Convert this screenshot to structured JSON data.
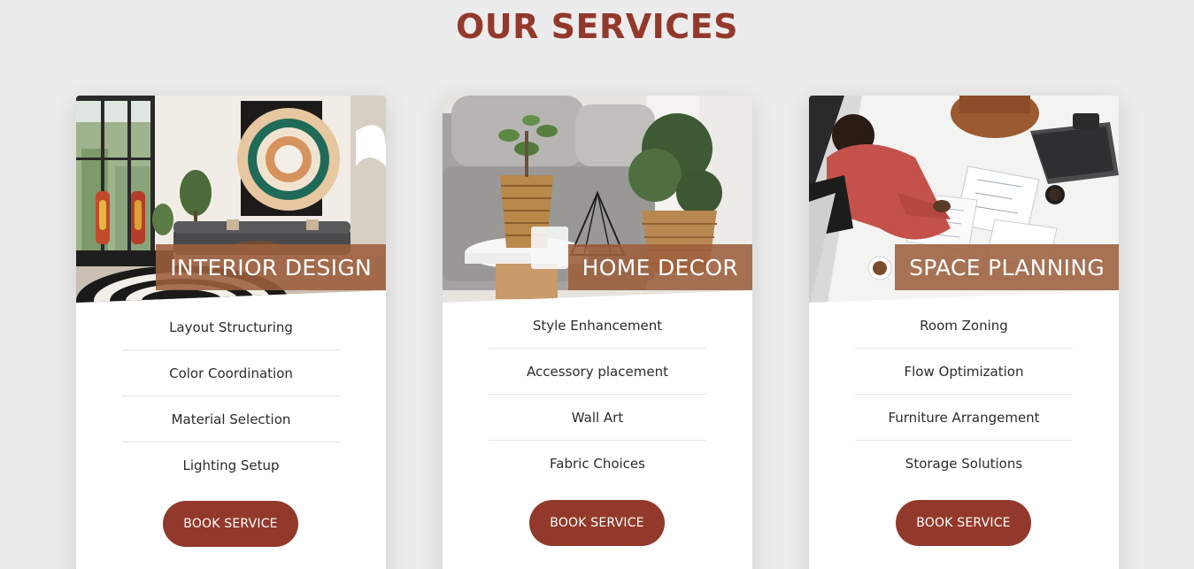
{
  "section": {
    "title": "OUR SERVICES"
  },
  "colors": {
    "accent": "#93392b",
    "label_background": "#9c5f3c",
    "page_background": "#ececec",
    "card_background": "#ffffff"
  },
  "cards": [
    {
      "title": "INTERIOR DESIGN",
      "image": "living-room-interior-photo",
      "features": [
        "Layout Structuring",
        "Color Coordination",
        "Material Selection",
        "Lighting Setup"
      ],
      "button_label": "BOOK SERVICE"
    },
    {
      "title": "HOME DECOR",
      "image": "potted-plant-decor-photo",
      "features": [
        "Style Enhancement",
        "Accessory placement",
        "Wall Art",
        "Fabric Choices"
      ],
      "button_label": "BOOK SERVICE"
    },
    {
      "title": "SPACE PLANNING",
      "image": "floor-plan-meeting-photo",
      "features": [
        "Room Zoning",
        "Flow Optimization",
        "Furniture Arrangement",
        "Storage Solutions"
      ],
      "button_label": "BOOK SERVICE"
    }
  ]
}
